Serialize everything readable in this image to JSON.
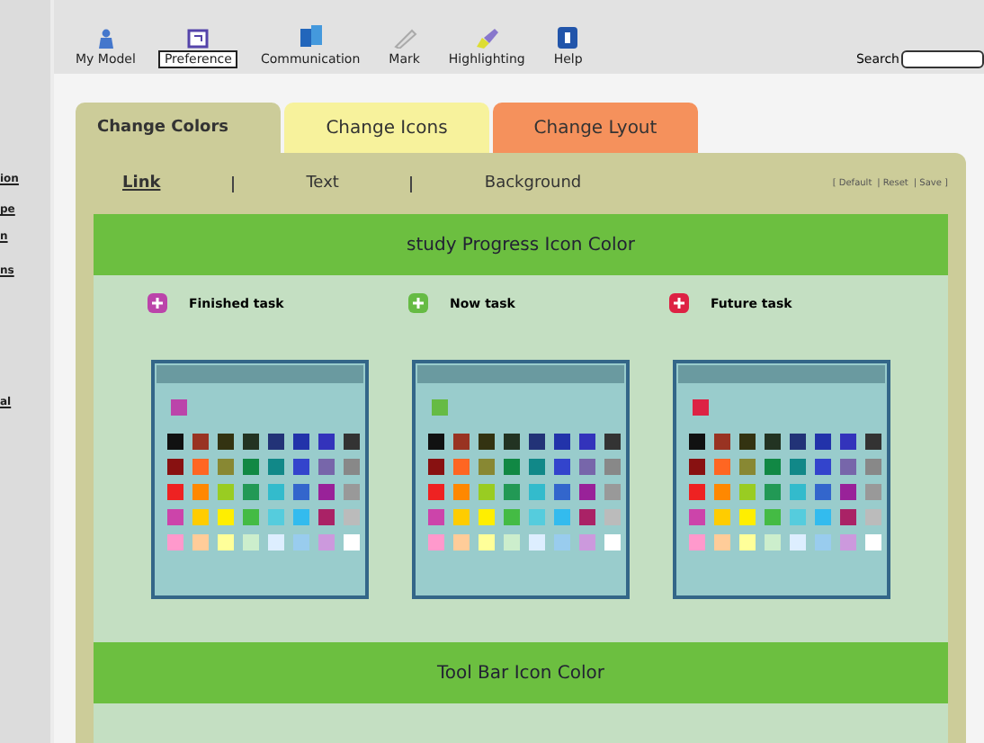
{
  "toolbar": [
    {
      "label": "My Model",
      "kind": "person",
      "selected": false
    },
    {
      "label": "Preference",
      "kind": "form",
      "selected": true
    },
    {
      "label": "Communication",
      "kind": "book",
      "selected": false
    },
    {
      "label": "Mark",
      "kind": "pen",
      "selected": false
    },
    {
      "label": "Highlighting",
      "kind": "marker",
      "selected": false
    },
    {
      "label": "Help",
      "kind": "help",
      "selected": false
    }
  ],
  "search": {
    "label": "Search"
  },
  "side_fragments": [
    "ion",
    "pe",
    "n",
    "ns",
    "al"
  ],
  "tabs": [
    {
      "label": "Change Colors",
      "selected": true,
      "color": "#cccc99"
    },
    {
      "label": "Change Icons",
      "selected": false,
      "color": "#f7f29c"
    },
    {
      "label": "Change Lyout",
      "selected": false,
      "color": "#f5915c"
    }
  ],
  "subtabs": [
    {
      "label": "Link",
      "selected": true
    },
    {
      "label": "Text",
      "selected": false
    },
    {
      "label": "Background",
      "selected": false
    }
  ],
  "actions": [
    "[ Default",
    "|  Reset",
    "|  Save ]"
  ],
  "sections": [
    "study Progress Icon Color",
    "Tool Bar Icon Color"
  ],
  "tasks": [
    {
      "label": "Finished task",
      "color": "#bb44aa"
    },
    {
      "label": "Now task",
      "color": "#66bb44"
    },
    {
      "label": "Future task",
      "color": "#dd2244"
    }
  ],
  "palette": [
    {
      "color": "#111111"
    },
    {
      "color": "#993322"
    },
    {
      "color": "#333311"
    },
    {
      "color": "#223322"
    },
    {
      "color": "#223377"
    },
    {
      "color": "#2233aa"
    },
    {
      "color": "#3333bb"
    },
    {
      "color": "#333333"
    },
    {
      "color": "#881111"
    },
    {
      "color": "#ff6622"
    },
    {
      "color": "#888833"
    },
    {
      "color": "#118844"
    },
    {
      "color": "#118888"
    },
    {
      "color": "#3344cc"
    },
    {
      "color": "#7766aa"
    },
    {
      "color": "#888888"
    },
    {
      "color": "#ee2222"
    },
    {
      "color": "#ff8800"
    },
    {
      "color": "#99cc22"
    },
    {
      "color": "#229955"
    },
    {
      "color": "#33bbcc"
    },
    {
      "color": "#3366cc"
    },
    {
      "color": "#992299"
    },
    {
      "color": "#999999"
    },
    {
      "color": "#cc44aa"
    },
    {
      "color": "#ffcc00"
    },
    {
      "color": "#ffee00"
    },
    {
      "color": "#44bb44"
    },
    {
      "color": "#55ccdd"
    },
    {
      "color": "#33bbee"
    },
    {
      "color": "#aa2266"
    },
    {
      "color": "#bbbbbb"
    },
    {
      "color": "#ff99cc"
    },
    {
      "color": "#ffcc99"
    },
    {
      "color": "#ffff99"
    },
    {
      "color": "#cceecc"
    },
    {
      "color": "#ddeeff"
    },
    {
      "color": "#99ccee"
    },
    {
      "color": "#cc99dd"
    },
    {
      "color": "#ffffff"
    }
  ]
}
